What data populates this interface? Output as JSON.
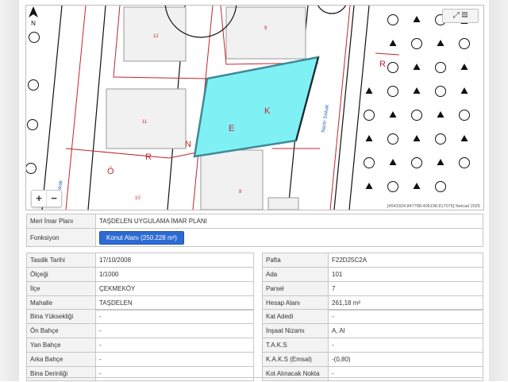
{
  "map": {
    "road_labels": {
      "ornek": [
        "Ö",
        "R",
        "N",
        "E",
        "K"
      ],
      "ornek_upper": [
        "E",
        "K"
      ],
      "narin": "Narin Sokak",
      "left_road": "Sokak",
      "r_right": "R"
    },
    "parcel_numbers": [
      "12",
      "9",
      "11",
      "8",
      "10"
    ],
    "zoom_in": "+",
    "zoom_out": "−",
    "tools_label": "⤢ ▦",
    "coordinates": "[4543324.847788:406198.817075] Netcad 2025",
    "north_label": "N",
    "highlight_color": "#7ff0f3"
  },
  "plan": {
    "meri_label": "Meri İmar Planı",
    "meri_value": "TAŞDELEN UYGULAMA İMAR PLANI",
    "fonksiyon_label": "Fonksiyon",
    "fonksiyon_value": "Konut Alanı (250.228 m²)"
  },
  "left1": [
    {
      "label": "Tasdik Tarihi",
      "value": "17/10/2008"
    },
    {
      "label": "Ölçeği",
      "value": "1/1000"
    },
    {
      "label": "İlçe",
      "value": "ÇEKMEKÖY"
    },
    {
      "label": "Mahalle",
      "value": "TAŞDELEN"
    }
  ],
  "right1": [
    {
      "label": "Pafta",
      "value": "F22D25C2A"
    },
    {
      "label": "Ada",
      "value": "101"
    },
    {
      "label": "Parsel",
      "value": "7"
    },
    {
      "label": "Hesap Alanı",
      "value": "261,18 m²"
    }
  ],
  "left2": [
    {
      "label": "Bina Yüksekliği",
      "value": "-"
    },
    {
      "label": "Ön Bahçe",
      "value": "-"
    },
    {
      "label": "Yan Bahçe",
      "value": "-"
    },
    {
      "label": "Arka Bahçe",
      "value": "-"
    },
    {
      "label": "Bina Derinliği",
      "value": "-"
    }
  ],
  "right2": [
    {
      "label": "Kat Adedi",
      "value": "-"
    },
    {
      "label": "İnşaat Nizamı",
      "value": "A, Al"
    },
    {
      "label": "T.A.K.S",
      "value": "-"
    },
    {
      "label": "K.A.K.S (Emsal)",
      "value": "-(0,80)"
    },
    {
      "label": "Kot Alınacak Nokta",
      "value": "-"
    }
  ]
}
